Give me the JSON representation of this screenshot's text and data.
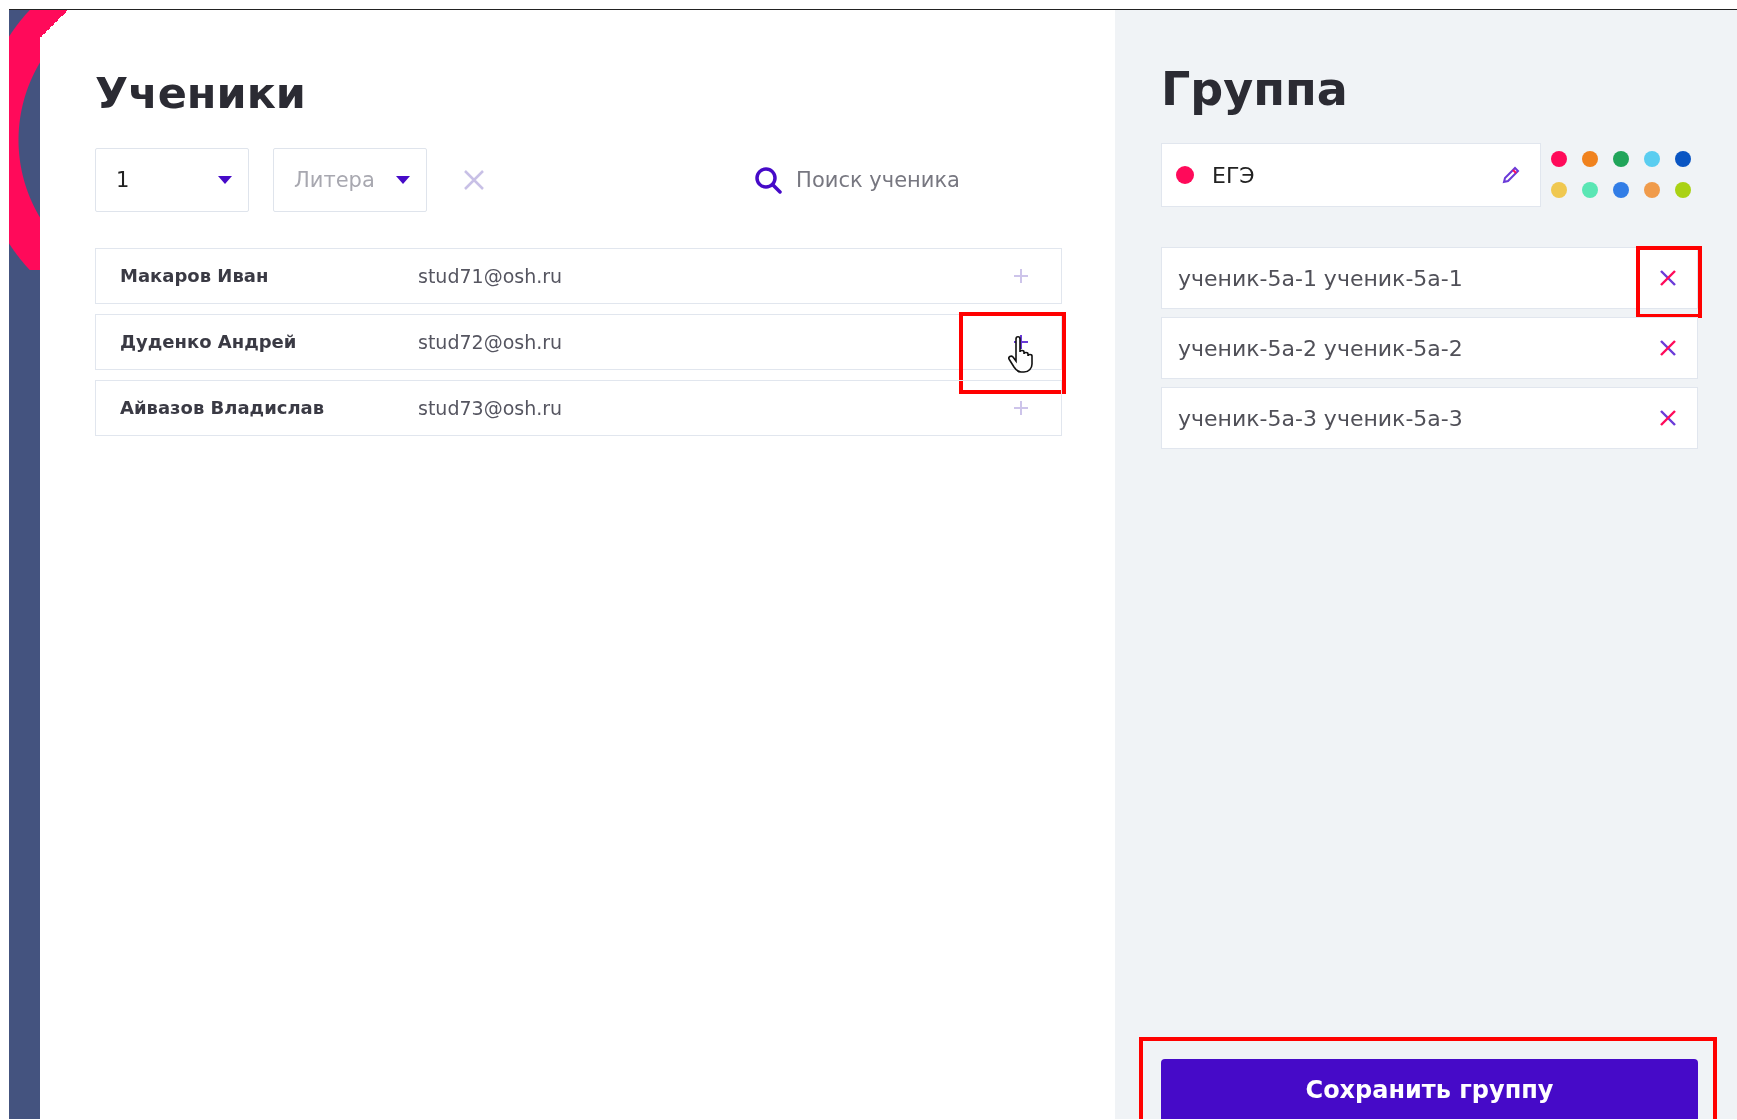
{
  "students": {
    "title": "Ученики",
    "filters": [
      {
        "kind": "value",
        "text": "1"
      },
      {
        "kind": "placeholder",
        "text": "Литера"
      }
    ],
    "search": {
      "placeholder": "Поиск ученика"
    },
    "rows": [
      {
        "name": "Макаров Иван",
        "email": "stud71@osh.ru",
        "highlighted": false,
        "hovered": false
      },
      {
        "name": "Дуденко Андрей",
        "email": "stud72@osh.ru",
        "highlighted": true,
        "hovered": true
      },
      {
        "name": "Айвазов Владислав",
        "email": "stud73@osh.ru",
        "highlighted": false,
        "hovered": false
      }
    ]
  },
  "group": {
    "title": "Группа",
    "name": "ЕГЭ",
    "color": "#ff0a5a",
    "palette": [
      {
        "color": "#ff0a5a"
      },
      {
        "color": "#f0821e"
      },
      {
        "color": "#21a55a"
      },
      {
        "color": "#5acdf0"
      },
      {
        "color": "#0a55c3"
      },
      {
        "color": "#f0c850"
      },
      {
        "color": "#5ae6b4"
      },
      {
        "color": "#327de6"
      },
      {
        "color": "#f09b4b"
      },
      {
        "color": "#aad214"
      }
    ],
    "members": [
      {
        "name": "ученик-5а-1 ученик-5а-1",
        "highlighted": true
      },
      {
        "name": "ученик-5а-2 ученик-5а-2",
        "highlighted": false
      },
      {
        "name": "ученик-5а-3 ученик-5а-3",
        "highlighted": false
      }
    ],
    "save_button": {
      "label": "Сохранить группу",
      "highlighted": true
    }
  }
}
